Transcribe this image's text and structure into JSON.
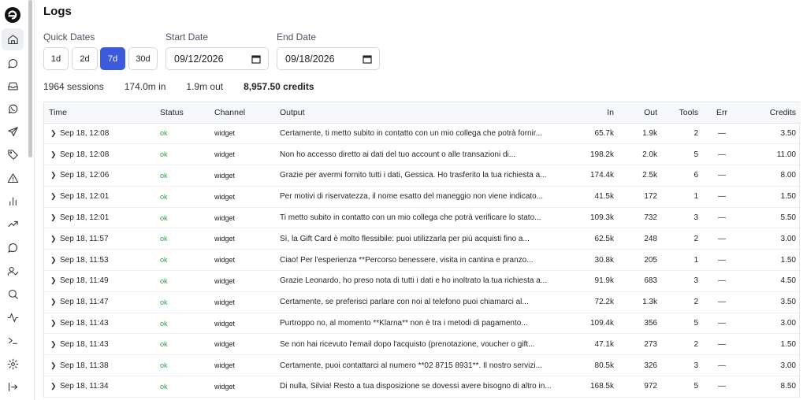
{
  "page": {
    "title": "Logs"
  },
  "sidebar": {
    "items": [
      {
        "name": "home-icon",
        "active": true
      },
      {
        "name": "chat-bubble-icon",
        "active": false
      },
      {
        "name": "inbox-icon",
        "active": false
      },
      {
        "name": "whatsapp-icon",
        "active": false
      },
      {
        "name": "send-icon",
        "active": false
      },
      {
        "name": "tag-icon",
        "active": false
      },
      {
        "name": "warning-icon",
        "active": false
      },
      {
        "name": "bar-chart-icon",
        "active": false
      },
      {
        "name": "trending-icon",
        "active": false
      },
      {
        "name": "message-circle-icon",
        "active": false
      },
      {
        "name": "user-check-icon",
        "active": false
      },
      {
        "name": "search-icon",
        "active": false
      },
      {
        "name": "activity-icon",
        "active": false
      },
      {
        "name": "terminal-icon",
        "active": false
      },
      {
        "name": "settings-icon",
        "active": false
      },
      {
        "name": "logout-icon",
        "active": false
      }
    ]
  },
  "filters": {
    "quick_dates_label": "Quick Dates",
    "quick_dates": [
      "1d",
      "2d",
      "7d",
      "30d"
    ],
    "quick_dates_selected": "7d",
    "start_date_label": "Start Date",
    "start_date": "09/12/2026",
    "end_date_label": "End Date",
    "end_date": "09/18/2026"
  },
  "stats": {
    "sessions": "1964 sessions",
    "tokens_in": "174.0m in",
    "tokens_out": "1.9m out",
    "credits": "8,957.50 credits"
  },
  "table": {
    "headers": {
      "time": "Time",
      "status": "Status",
      "channel": "Channel",
      "output": "Output",
      "in": "In",
      "out": "Out",
      "tools": "Tools",
      "err": "Err",
      "credits": "Credits"
    },
    "rows": [
      {
        "time": "Sep 18, 12:08",
        "status": "ok",
        "channel": "widget",
        "output": "Certamente, ti metto subito in contatto con un mio collega che potrà fornir...",
        "in": "65.7k",
        "out": "1.9k",
        "tools": "2",
        "err": "—",
        "credits": "3.50"
      },
      {
        "time": "Sep 18, 12:08",
        "status": "ok",
        "channel": "widget",
        "output": "Non ho accesso diretto ai dati del tuo account o alle transazioni di...",
        "in": "198.2k",
        "out": "2.0k",
        "tools": "5",
        "err": "—",
        "credits": "11.00"
      },
      {
        "time": "Sep 18, 12:06",
        "status": "ok",
        "channel": "widget",
        "output": "Grazie per avermi fornito tutti i dati, Gessica. Ho trasferito la tua richiesta a...",
        "in": "174.4k",
        "out": "2.5k",
        "tools": "6",
        "err": "—",
        "credits": "8.00"
      },
      {
        "time": "Sep 18, 12:01",
        "status": "ok",
        "channel": "widget",
        "output": "Per motivi di riservatezza, il nome esatto del maneggio non viene indicato...",
        "in": "41.5k",
        "out": "172",
        "tools": "1",
        "err": "—",
        "credits": "1.50"
      },
      {
        "time": "Sep 18, 12:01",
        "status": "ok",
        "channel": "widget",
        "output": "Ti metto subito in contatto con un mio collega che potrà verificare lo stato...",
        "in": "109.3k",
        "out": "732",
        "tools": "3",
        "err": "—",
        "credits": "5.50"
      },
      {
        "time": "Sep 18, 11:57",
        "status": "ok",
        "channel": "widget",
        "output": "Sì, la Gift Card è molto flessibile: puoi utilizzarla per più acquisti fino a...",
        "in": "62.5k",
        "out": "248",
        "tools": "2",
        "err": "—",
        "credits": "3.00"
      },
      {
        "time": "Sep 18, 11:53",
        "status": "ok",
        "channel": "widget",
        "output": "Ciao! Per l'esperienza **Percorso benessere, visita in cantina e pranzo...",
        "in": "30.8k",
        "out": "205",
        "tools": "1",
        "err": "—",
        "credits": "1.50"
      },
      {
        "time": "Sep 18, 11:49",
        "status": "ok",
        "channel": "widget",
        "output": "Grazie Leonardo, ho preso nota di tutti i dati e ho inoltrato la tua richiesta a...",
        "in": "91.9k",
        "out": "683",
        "tools": "3",
        "err": "—",
        "credits": "4.50"
      },
      {
        "time": "Sep 18, 11:47",
        "status": "ok",
        "channel": "widget",
        "output": "Certamente, se preferisci parlare con noi al telefono puoi chiamarci al...",
        "in": "72.2k",
        "out": "1.3k",
        "tools": "2",
        "err": "—",
        "credits": "3.50"
      },
      {
        "time": "Sep 18, 11:43",
        "status": "ok",
        "channel": "widget",
        "output": "Purtroppo no, al momento **Klarna** non è tra i metodi di pagamento...",
        "in": "109.4k",
        "out": "356",
        "tools": "5",
        "err": "—",
        "credits": "3.00"
      },
      {
        "time": "Sep 18, 11:43",
        "status": "ok",
        "channel": "widget",
        "output": "Se non hai ricevuto l'email dopo l'acquisto (prenotazione, voucher o gift...",
        "in": "47.1k",
        "out": "273",
        "tools": "2",
        "err": "—",
        "credits": "1.50"
      },
      {
        "time": "Sep 18, 11:38",
        "status": "ok",
        "channel": "widget",
        "output": "Certamente, puoi contattarci al numero **02 8715 8931**. Il nostro servizi...",
        "in": "80.5k",
        "out": "326",
        "tools": "3",
        "err": "—",
        "credits": "3.00"
      },
      {
        "time": "Sep 18, 11:34",
        "status": "ok",
        "channel": "widget",
        "output": "Di nulla, Silvia! Resto a tua disposizione se dovessi avere bisogno di altro in...",
        "in": "168.5k",
        "out": "972",
        "tools": "5",
        "err": "—",
        "credits": "8.50"
      }
    ]
  }
}
